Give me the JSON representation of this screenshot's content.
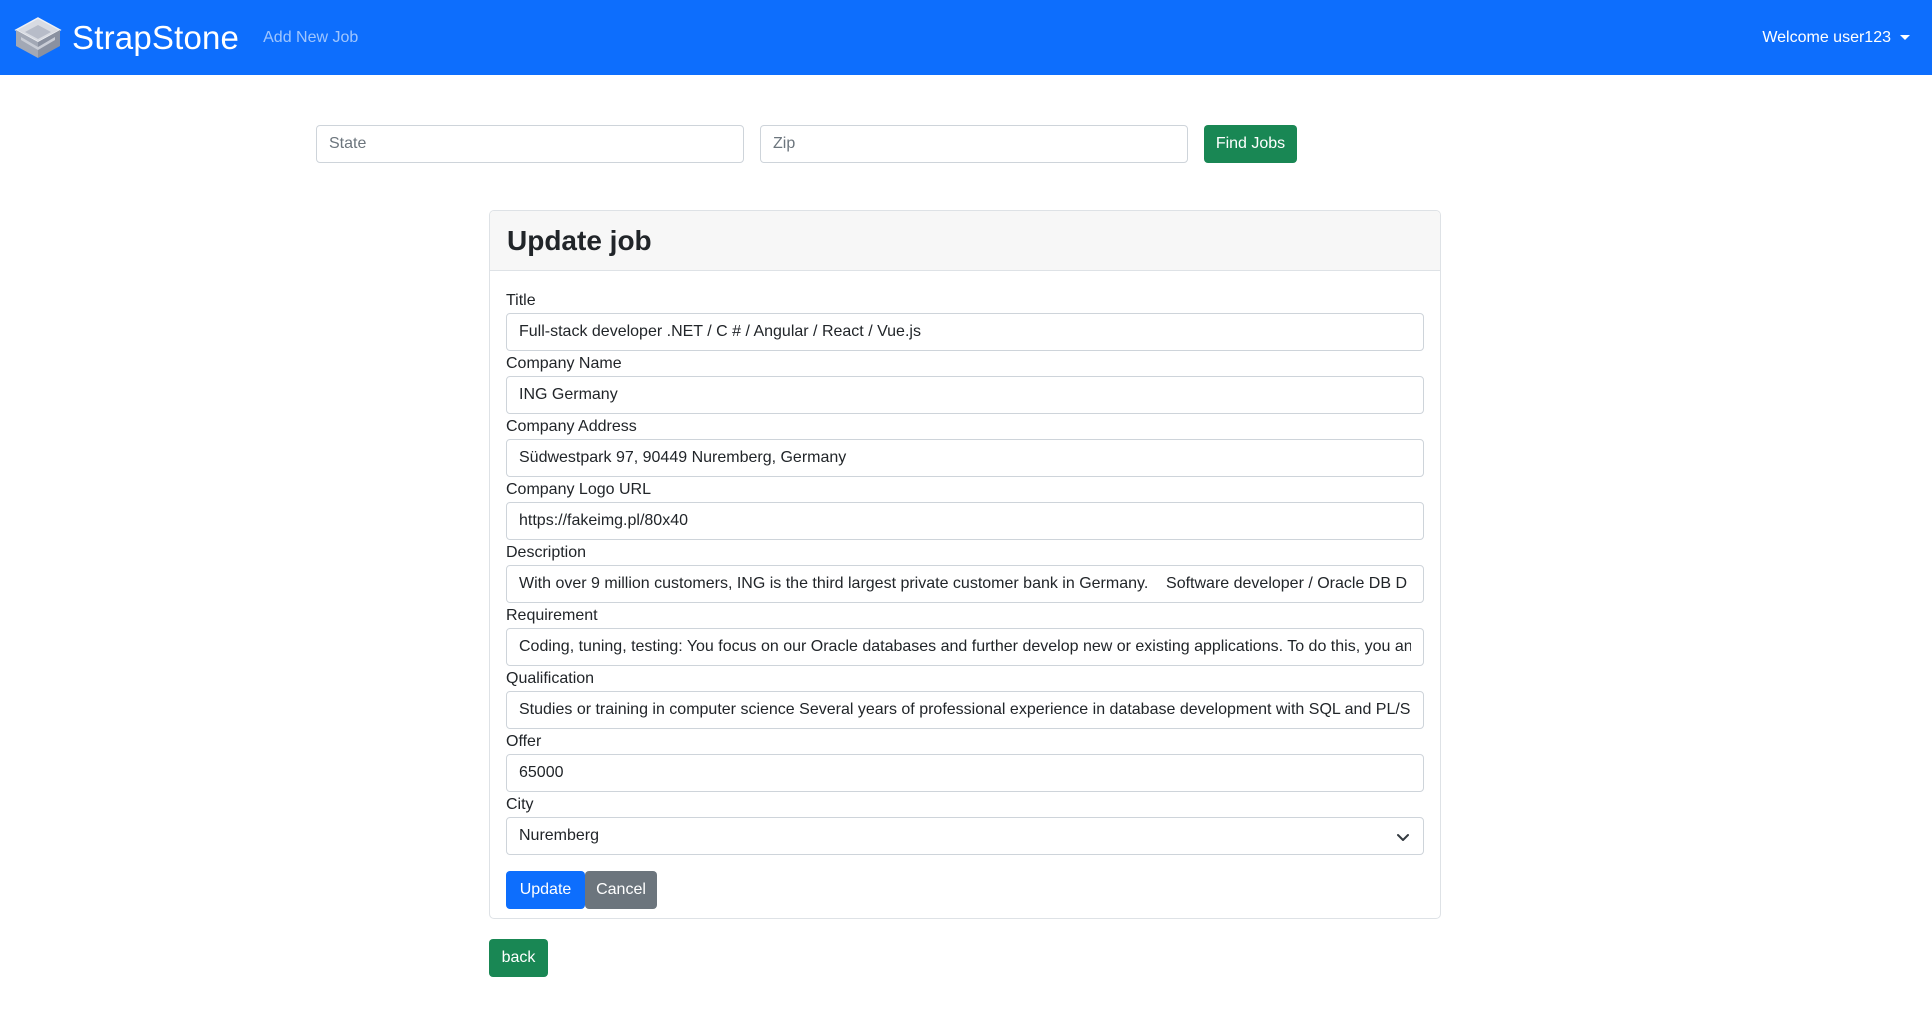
{
  "navbar": {
    "brand": "StrapStone",
    "add_job": "Add New Job",
    "user_menu": "Welcome user123",
    "brand_color": "#0d6efd"
  },
  "search": {
    "state_placeholder": "State",
    "zip_placeholder": "Zip",
    "find_button": "Find Jobs"
  },
  "form": {
    "heading": "Update job",
    "fields": {
      "title": {
        "label": "Title",
        "value": "Full-stack developer .NET / C # / Angular / React / Vue.js"
      },
      "company_name": {
        "label": "Company Name",
        "value": "ING Germany"
      },
      "company_address": {
        "label": "Company Address",
        "value": "Südwestpark 97, 90449 Nuremberg, Germany"
      },
      "logo_url": {
        "label": "Company Logo URL",
        "value": "https://fakeimg.pl/80x40"
      },
      "description": {
        "label": "Description",
        "value": "With over 9 million customers, ING is the third largest private customer bank in Germany.    Software developer / Oracle DB D"
      },
      "requirement": {
        "label": "Requirement",
        "value": "Coding, tuning, testing: You focus on our Oracle databases and further develop new or existing applications. To do this, you an"
      },
      "qualification": {
        "label": "Qualification",
        "value": "Studies or training in computer science Several years of professional experience in database development with SQL and PL/SQ"
      },
      "offer": {
        "label": "Offer",
        "value": "65000"
      },
      "city": {
        "label": "City",
        "selected": "Nuremberg"
      }
    },
    "update_button": "Update",
    "cancel_button": "Cancel"
  },
  "back_button": "back",
  "colors": {
    "primary": "#0d6efd",
    "success": "#198754",
    "secondary": "#6c757d"
  }
}
